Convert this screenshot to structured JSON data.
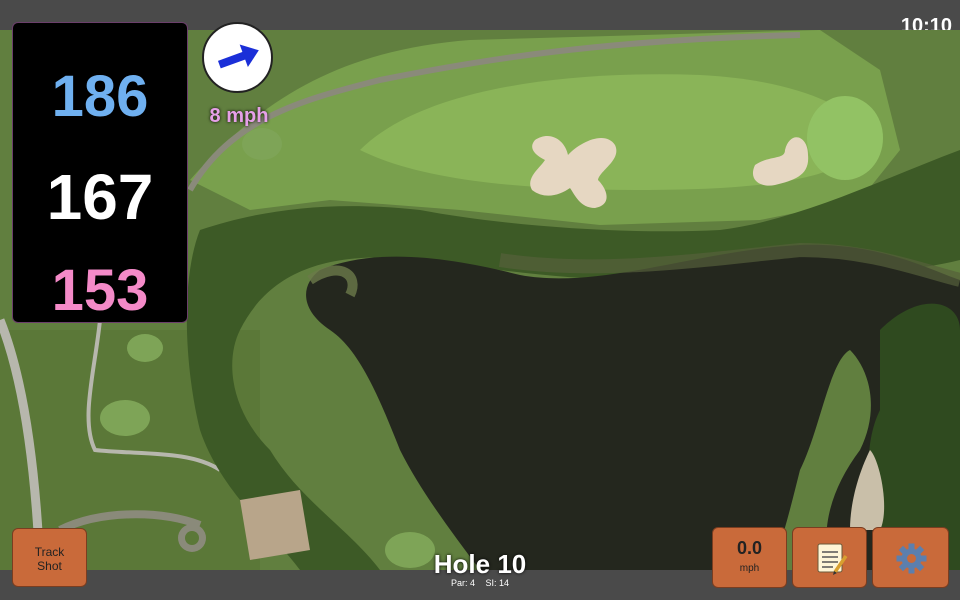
{
  "status": {
    "time": "10:10"
  },
  "distances": {
    "back": "186",
    "middle": "167",
    "front": "153"
  },
  "wind": {
    "speed": "8 mph",
    "icon": "wind-direction-arrow-icon"
  },
  "hole": {
    "title": "Hole 10",
    "par": "Par: 4",
    "stroke_index": "SI: 14"
  },
  "buttons": {
    "track_shot": {
      "line1": "Track",
      "line2": "Shot"
    },
    "speed": {
      "value": "0.0",
      "unit": "mph"
    },
    "notes_icon": "notepad-icon",
    "settings_icon": "gear-icon"
  },
  "colors": {
    "back_distance": "#6fb0f0",
    "middle_distance": "#ffffff",
    "front_distance": "#f48ac8",
    "wind_text": "#e6a0e8",
    "button_bg": "#c96a3a",
    "bar_bg": "#4a4a4a"
  }
}
